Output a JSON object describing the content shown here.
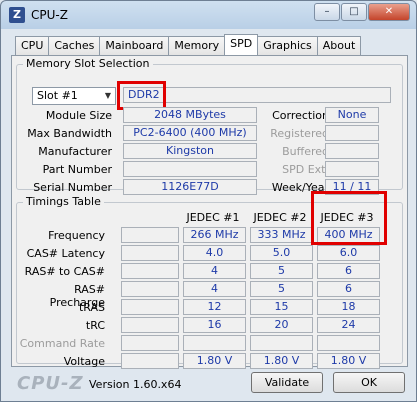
{
  "window": {
    "title": "CPU-Z",
    "icon_label": "Z",
    "controls": {
      "minimize": "–",
      "maximize": "□",
      "close": "✕"
    }
  },
  "tabs": [
    {
      "label": "CPU"
    },
    {
      "label": "Caches"
    },
    {
      "label": "Mainboard"
    },
    {
      "label": "Memory"
    },
    {
      "label": "SPD",
      "active": true
    },
    {
      "label": "Graphics"
    },
    {
      "label": "About"
    }
  ],
  "memory_slot": {
    "group_title": "Memory Slot Selection",
    "slot_selected": "Slot #1",
    "memory_type": "DDR2",
    "module_size_label": "Module Size",
    "module_size": "2048 MBytes",
    "max_bandwidth_label": "Max Bandwidth",
    "max_bandwidth": "PC2-6400 (400 MHz)",
    "manufacturer_label": "Manufacturer",
    "manufacturer": "Kingston",
    "part_number_label": "Part Number",
    "part_number": "",
    "serial_number_label": "Serial Number",
    "serial_number": "1126E77D",
    "correction_label": "Correction",
    "correction": "None",
    "registered_label": "Registered",
    "buffered_label": "Buffered",
    "spd_ext_label": "SPD Ext.",
    "week_year_label": "Week/Year",
    "week_year": "11 / 11"
  },
  "timings": {
    "group_title": "Timings Table",
    "columns": [
      "JEDEC #1",
      "JEDEC #2",
      "JEDEC #3"
    ],
    "rows": [
      {
        "label": "Frequency",
        "values": [
          "266 MHz",
          "333 MHz",
          "400 MHz"
        ]
      },
      {
        "label": "CAS# Latency",
        "values": [
          "4.0",
          "5.0",
          "6.0"
        ]
      },
      {
        "label": "RAS# to CAS#",
        "values": [
          "4",
          "5",
          "6"
        ]
      },
      {
        "label": "RAS# Precharge",
        "values": [
          "4",
          "5",
          "6"
        ]
      },
      {
        "label": "tRAS",
        "values": [
          "12",
          "15",
          "18"
        ]
      },
      {
        "label": "tRC",
        "values": [
          "16",
          "20",
          "24"
        ]
      },
      {
        "label": "Command Rate",
        "values": [
          "",
          "",
          ""
        ],
        "dim": true
      },
      {
        "label": "Voltage",
        "values": [
          "1.80 V",
          "1.80 V",
          "1.80 V"
        ]
      }
    ]
  },
  "footer": {
    "brand": "CPU-Z",
    "version": "Version 1.60.x64",
    "validate_label": "Validate",
    "ok_label": "OK"
  },
  "colors": {
    "value_text": "#1e3aa8",
    "highlight": "#e00000"
  }
}
